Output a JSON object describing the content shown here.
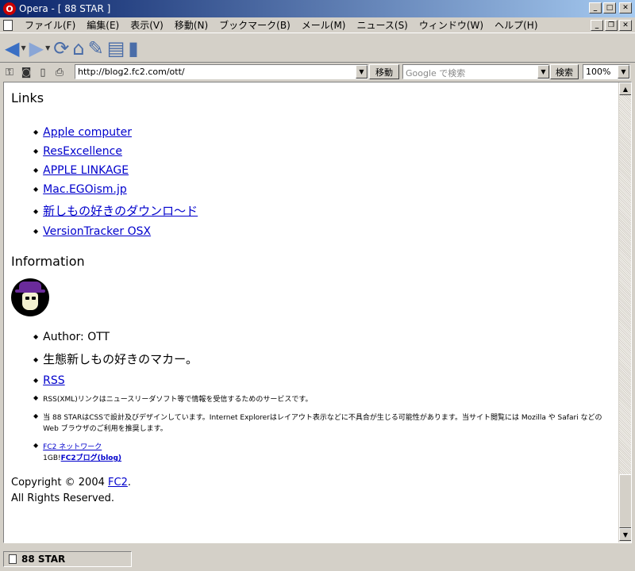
{
  "window": {
    "title": "Opera - [ 88 STAR ]",
    "app_glyph": "O"
  },
  "menu": {
    "items": [
      "ファイル(F)",
      "編集(E)",
      "表示(V)",
      "移動(N)",
      "ブックマーク(B)",
      "メール(M)",
      "ニュース(S)",
      "ウィンドウ(W)",
      "ヘルプ(H)"
    ]
  },
  "address": {
    "url": "http://blog2.fc2.com/ott/",
    "go_label": "移動",
    "search_placeholder": "Google で検索",
    "search_label": "検索",
    "zoom": "100%"
  },
  "content": {
    "links_title": "Links",
    "links": [
      "Apple computer",
      "ResExcellence",
      "APPLE LINKAGE",
      "Mac.EGOism.jp",
      "新しもの好きのダウンロ〜ド",
      "VersionTracker OSX"
    ],
    "info_title": "Information",
    "author": "Author: OTT",
    "tagline": "生態新しもの好きのマカー。",
    "rss_label": "RSS",
    "rss_desc": "RSS(XML)リンクはニュースリーダソフト等で情報を受信するためのサービスです。",
    "css_note": "当 88 STARはCSSで設計及びデザインしています。Internet Explorerはレイアウト表示などに不具合が生じる可能性があります。当サイト閲覧には Mozilla や Safari などのWeb ブラウザのご利用を推奨します。",
    "fc2_network": "FC2 ネットワーク",
    "fc2_prefix": "1GB!",
    "fc2_blog": "FC2ブログ(blog)",
    "copyright_line1": "Copyright © 2004 ",
    "copyright_link": "FC2",
    "copyright_dot": ".",
    "copyright_line2": "All Rights Reserved."
  },
  "status": {
    "text": "88 STAR"
  },
  "colors": {
    "link": "#0000cc",
    "titlebar_start": "#0a246a",
    "titlebar_end": "#a6caf0"
  }
}
